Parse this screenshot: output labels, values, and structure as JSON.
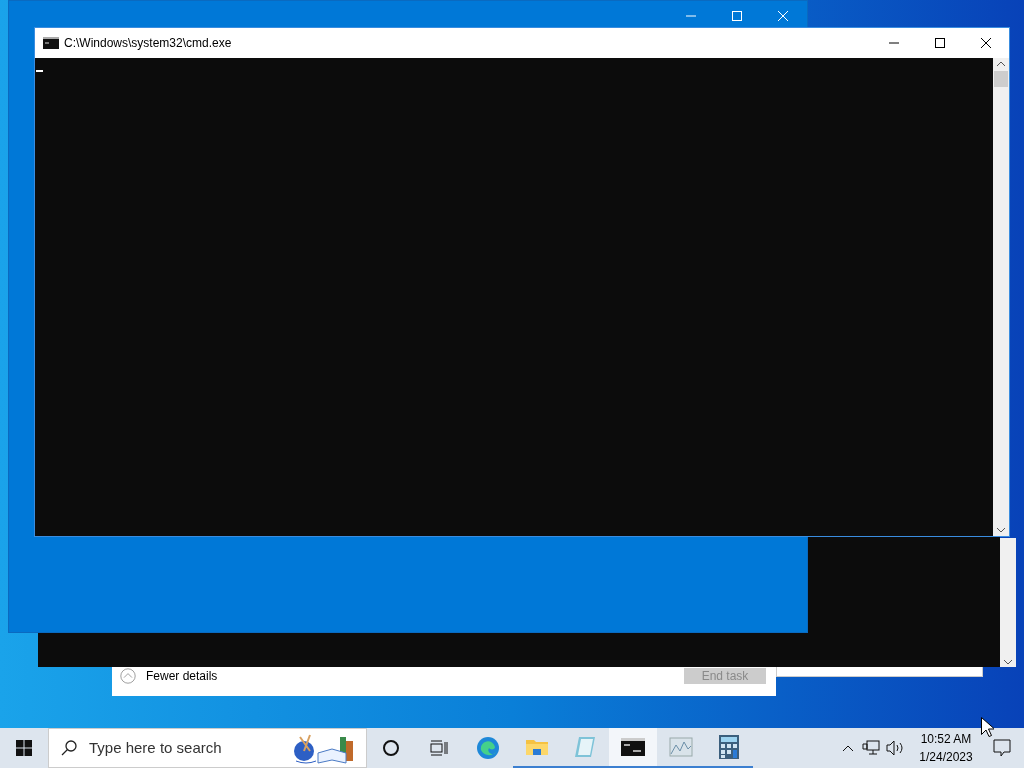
{
  "console_window": {
    "title": "C:\\Windows\\system32\\cmd.exe"
  },
  "task_manager": {
    "toggle_label": "Fewer details",
    "end_task": {
      "label": "End task",
      "disabled": true
    }
  },
  "taskbar": {
    "search": {
      "placeholder": "Type here to search"
    },
    "apps": [
      {
        "kind": "explorer",
        "selected": false
      },
      {
        "kind": "notepad",
        "selected": false
      },
      {
        "kind": "console",
        "selected": true
      },
      {
        "kind": "monitor",
        "selected": false
      },
      {
        "kind": "calculator",
        "selected": false
      }
    ],
    "clock": {
      "time": "10:52 AM",
      "date": "1/24/2023"
    }
  }
}
